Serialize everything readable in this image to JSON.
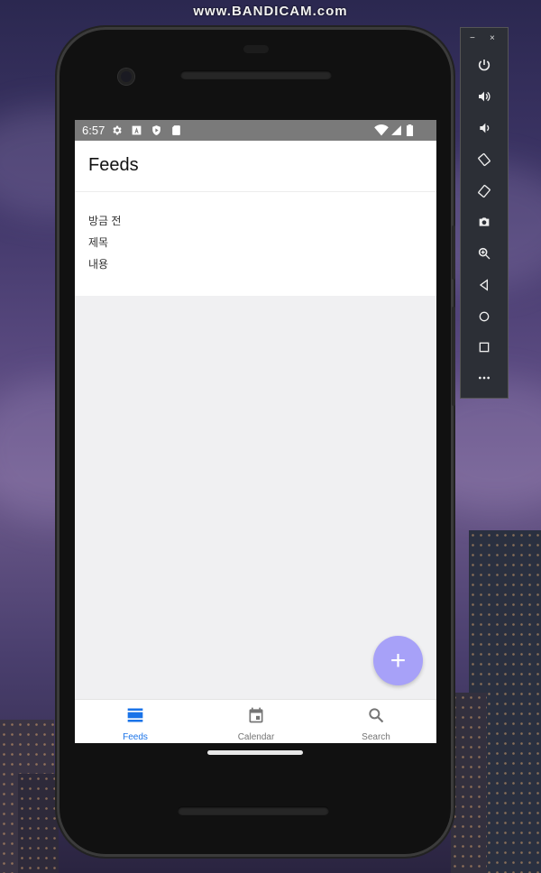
{
  "watermark": "www.BANDICAM.com",
  "status_bar": {
    "time": "6:57"
  },
  "header": {
    "title": "Feeds"
  },
  "feed_item": {
    "time": "방금 전",
    "title": "제목",
    "content": "내용"
  },
  "fab": {
    "label": "+"
  },
  "tabs": [
    {
      "label": "Feeds",
      "icon": "view-day-icon",
      "active": true
    },
    {
      "label": "Calendar",
      "icon": "calendar-icon",
      "active": false
    },
    {
      "label": "Search",
      "icon": "search-icon",
      "active": false
    }
  ],
  "colors": {
    "accent": "#1a73e8",
    "fab": "#a7a1f8",
    "inactive": "#757575"
  },
  "emulator_panel": {
    "window_controls": [
      "−",
      "×"
    ],
    "buttons": [
      "power-icon",
      "volume-up-icon",
      "volume-down-icon",
      "rotate-left-icon",
      "rotate-right-icon",
      "camera-icon",
      "zoom-icon",
      "back-icon",
      "home-icon",
      "overview-icon",
      "more-icon"
    ]
  }
}
